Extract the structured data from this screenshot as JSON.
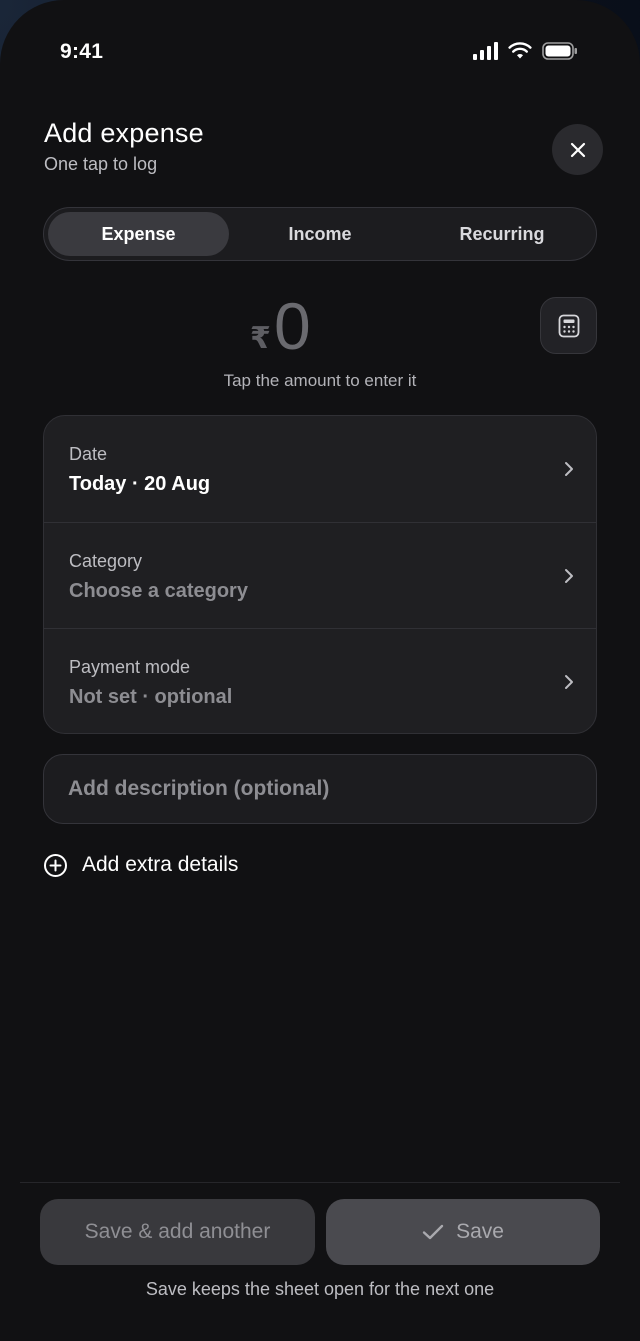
{
  "status_bar": {
    "time": "9:41",
    "icons": [
      "signal-icon",
      "wifi-icon",
      "battery-icon"
    ]
  },
  "header": {
    "title": "Add expense",
    "subtitle": "One tap to log",
    "close_icon": "close-icon"
  },
  "tabs": [
    {
      "label": "Expense",
      "active": true
    },
    {
      "label": "Income",
      "active": false
    },
    {
      "label": "Recurring",
      "active": false
    }
  ],
  "amount": {
    "currency": "₹",
    "value": "0",
    "hint": "Tap the amount to enter it",
    "calculator_icon": "calculator-icon"
  },
  "fields": [
    {
      "label": "Date",
      "value": "Today · 20 Aug",
      "filled": true
    },
    {
      "label": "Category",
      "value": "Choose a category",
      "filled": false
    },
    {
      "label": "Payment mode",
      "value": "Not set · optional",
      "filled": false
    }
  ],
  "description": {
    "placeholder": "Add description (optional)"
  },
  "extra_details": {
    "label": "Add extra details",
    "icon": "plus-circle-icon"
  },
  "footer": {
    "save_another_label": "Save & add another",
    "save_label": "Save",
    "note": "Save keeps the sheet open for the next one"
  },
  "colors": {
    "background": "#111113",
    "surface": "#1f1f22",
    "active_tab": "#3a3a3f",
    "muted_text": "#8d8d92"
  }
}
